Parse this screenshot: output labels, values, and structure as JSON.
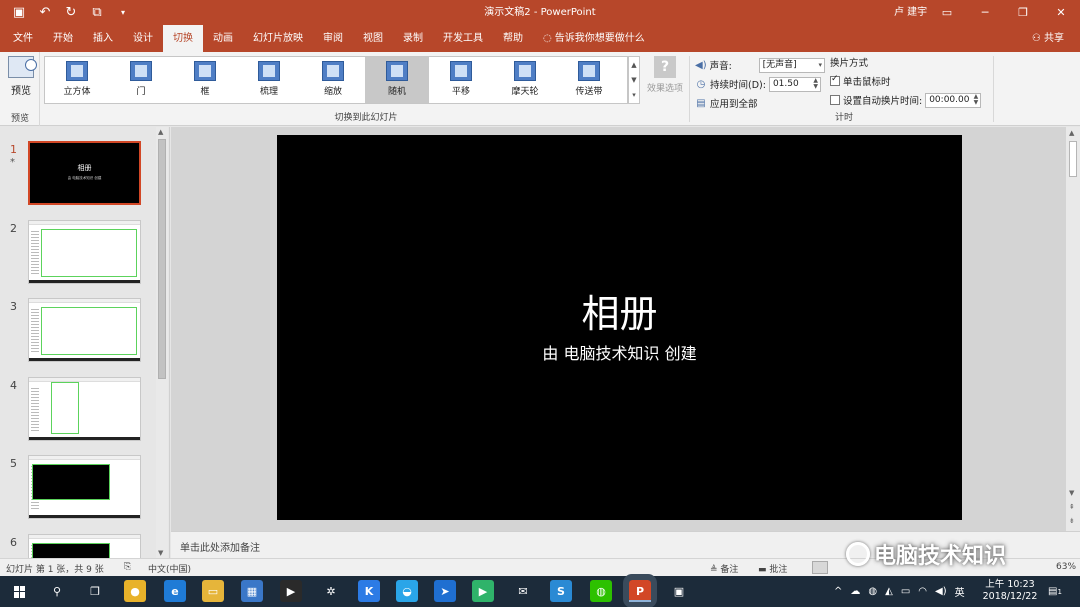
{
  "app": {
    "window_title": "演示文稿2  -  PowerPoint",
    "user_name": "卢 建宇",
    "share_label": "共享"
  },
  "tabs": [
    {
      "label": "文件"
    },
    {
      "label": "开始"
    },
    {
      "label": "插入"
    },
    {
      "label": "设计"
    },
    {
      "label": "切换",
      "active": true
    },
    {
      "label": "动画"
    },
    {
      "label": "幻灯片放映"
    },
    {
      "label": "审阅"
    },
    {
      "label": "视图"
    },
    {
      "label": "录制"
    },
    {
      "label": "开发工具"
    },
    {
      "label": "帮助"
    }
  ],
  "tell_me": "告诉我你想要做什么",
  "ribbon": {
    "preview": {
      "button_label": "预览",
      "group_label": "预览"
    },
    "transitions": {
      "items": [
        {
          "label": "立方体",
          "icon": "cube-transition-icon"
        },
        {
          "label": "门",
          "icon": "doors-transition-icon"
        },
        {
          "label": "框",
          "icon": "box-transition-icon"
        },
        {
          "label": "梳理",
          "icon": "comb-transition-icon"
        },
        {
          "label": "缩放",
          "icon": "zoom-transition-icon"
        },
        {
          "label": "随机",
          "icon": "random-transition-icon",
          "selected": true
        },
        {
          "label": "平移",
          "icon": "pan-transition-icon"
        },
        {
          "label": "摩天轮",
          "icon": "ferris-wheel-transition-icon"
        },
        {
          "label": "传送带",
          "icon": "conveyor-transition-icon"
        }
      ],
      "effect_options_label": "效果选项",
      "group_label": "切换到此幻灯片"
    },
    "timing": {
      "sound_label": "声音:",
      "sound_value": "[无声音]",
      "duration_label": "持续时间(D):",
      "duration_value": "01.50",
      "apply_all_label": "应用到全部",
      "advance_head": "换片方式",
      "on_click_label": "单击鼠标时",
      "on_click_checked": true,
      "after_label": "设置自动换片时间:",
      "after_checked": false,
      "after_value": "00:00.00",
      "group_label": "计时"
    }
  },
  "thumbnails": [
    {
      "num": "1",
      "kind": "title",
      "active": true,
      "starred": true,
      "title": "相册",
      "subtitle": "由 电脑技术知识 创建"
    },
    {
      "num": "2",
      "kind": "screenshot"
    },
    {
      "num": "3",
      "kind": "screenshot"
    },
    {
      "num": "4",
      "kind": "screenshot"
    },
    {
      "num": "5",
      "kind": "screenshot-dark"
    },
    {
      "num": "6",
      "kind": "screenshot-dark"
    }
  ],
  "slide": {
    "title": "相册",
    "subtitle": "由 电脑技术知识 创建"
  },
  "notes_placeholder": "单击此处添加备注",
  "status": {
    "slide_info": "幻灯片 第 1 张，共 9 张",
    "language": "中文(中国)",
    "notes_label": "备注",
    "comments_label": "批注",
    "zoom_tail": "63%"
  },
  "watermark": "电脑技术知识",
  "taskbar": {
    "apps": [
      {
        "name": "search-icon",
        "glyph": "⚲",
        "color": ""
      },
      {
        "name": "task-view-icon",
        "glyph": "❐",
        "color": ""
      },
      {
        "name": "chrome-icon",
        "glyph": "●",
        "color": "#e8b22a"
      },
      {
        "name": "edge-icon",
        "glyph": "e",
        "color": "#1f7bd6"
      },
      {
        "name": "file-explorer-icon",
        "glyph": "▭",
        "color": "#e6b53a"
      },
      {
        "name": "store-icon",
        "glyph": "▦",
        "color": "#3a77c8"
      },
      {
        "name": "video-icon",
        "glyph": "▶",
        "color": "#2a2a2a"
      },
      {
        "name": "settings-icon",
        "glyph": "✲",
        "color": ""
      },
      {
        "name": "app-k-icon",
        "glyph": "K",
        "color": "#2c7be5"
      },
      {
        "name": "app-cloud-icon",
        "glyph": "◒",
        "color": "#2aa5e8"
      },
      {
        "name": "app-arrow-icon",
        "glyph": "➤",
        "color": "#1f6fd1"
      },
      {
        "name": "play-icon",
        "glyph": "▶",
        "color": "#2fb36a"
      },
      {
        "name": "mail-icon",
        "glyph": "✉",
        "color": ""
      },
      {
        "name": "app-s-icon",
        "glyph": "S",
        "color": "#2a8ad4"
      },
      {
        "name": "wechat-icon",
        "glyph": "◍",
        "color": "#2dc100"
      },
      {
        "name": "powerpoint-icon",
        "glyph": "P",
        "color": "#d24726"
      },
      {
        "name": "app-window-icon",
        "glyph": "▣",
        "color": ""
      }
    ],
    "ime": "英",
    "time": "上午 10:23",
    "date": "2018/12/22",
    "notification_count": "1"
  },
  "colors": {
    "ppt_accent": "#b7472a",
    "selected_thumb_border": "#d24726",
    "taskbar": "#1c2b3a"
  }
}
